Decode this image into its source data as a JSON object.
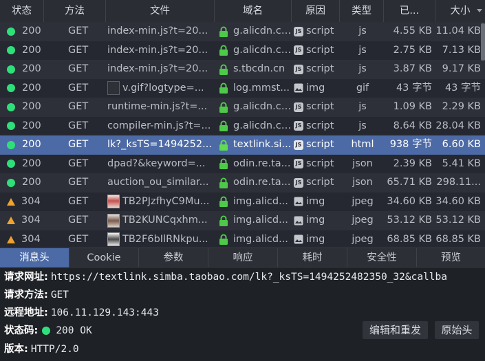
{
  "table": {
    "headers": {
      "status": "状态",
      "method": "方法",
      "file": "文件",
      "domain": "域名",
      "cause": "原因",
      "type": "类型",
      "transferred": "已...",
      "size": "大小"
    },
    "rows": [
      {
        "status": "200",
        "status_kind": "ok",
        "method": "GET",
        "file": "index-min.js?t=20...",
        "thumb": "",
        "domain": "g.alicdn.co...",
        "cause": "script",
        "cause_icon": "js",
        "type": "js",
        "transferred": "4.55 KB",
        "size": "11.04 KB"
      },
      {
        "status": "200",
        "status_kind": "ok",
        "method": "GET",
        "file": "index-min.js?t=20...",
        "thumb": "",
        "domain": "g.alicdn.co...",
        "cause": "script",
        "cause_icon": "js",
        "type": "js",
        "transferred": "2.75 KB",
        "size": "7.13 KB"
      },
      {
        "status": "200",
        "status_kind": "ok",
        "method": "GET",
        "file": "index-min.js?t=20...",
        "thumb": "",
        "domain": "s.tbcdn.cn",
        "cause": "script",
        "cause_icon": "js",
        "type": "js",
        "transferred": "3.87 KB",
        "size": "9.17 KB"
      },
      {
        "status": "200",
        "status_kind": "ok",
        "method": "GET",
        "file": "v.gif?logtype=...",
        "thumb": "blank",
        "domain": "log.mmst...",
        "cause": "img",
        "cause_icon": "js",
        "type": "gif",
        "transferred": "43 字节",
        "size": "43 字节"
      },
      {
        "status": "200",
        "status_kind": "ok",
        "method": "GET",
        "file": "runtime-min.js?t=...",
        "thumb": "",
        "domain": "g.alicdn.co...",
        "cause": "script",
        "cause_icon": "js",
        "type": "js",
        "transferred": "1.09 KB",
        "size": "2.29 KB"
      },
      {
        "status": "200",
        "status_kind": "ok",
        "method": "GET",
        "file": "compiler-min.js?t=...",
        "thumb": "",
        "domain": "g.alicdn.co...",
        "cause": "script",
        "cause_icon": "js",
        "type": "js",
        "transferred": "8.64 KB",
        "size": "28.04 KB"
      },
      {
        "status": "200",
        "status_kind": "ok",
        "method": "GET",
        "file": "lk?_ksTS=1494252...",
        "thumb": "",
        "domain": "textlink.si...",
        "cause": "script",
        "cause_icon": "js",
        "type": "html",
        "transferred": "938 字节",
        "size": "6.60 KB",
        "selected": true
      },
      {
        "status": "200",
        "status_kind": "ok",
        "method": "GET",
        "file": "dpad?&keyword=...",
        "thumb": "",
        "domain": "odin.re.ta...",
        "cause": "script",
        "cause_icon": "js",
        "type": "json",
        "transferred": "2.39 KB",
        "size": "5.41 KB"
      },
      {
        "status": "200",
        "status_kind": "ok",
        "method": "GET",
        "file": "auction_ou_similar...",
        "thumb": "",
        "domain": "odin.re.ta...",
        "cause": "script",
        "cause_icon": "js",
        "type": "json",
        "transferred": "65.71 KB",
        "size": "298.11..."
      },
      {
        "status": "304",
        "status_kind": "warn",
        "method": "GET",
        "file": "TB2PJzfhyC9Mu...",
        "thumb": "img1",
        "domain": "img.alicd...",
        "cause": "img",
        "cause_icon": "js",
        "type": "jpeg",
        "transferred": "34.60 KB",
        "size": "34.60 KB"
      },
      {
        "status": "304",
        "status_kind": "warn",
        "method": "GET",
        "file": "TB2KUNCqxhm...",
        "thumb": "img2",
        "domain": "img.alicd...",
        "cause": "img",
        "cause_icon": "js",
        "type": "jpeg",
        "transferred": "53.12 KB",
        "size": "53.12 KB"
      },
      {
        "status": "304",
        "status_kind": "warn",
        "method": "GET",
        "file": "TB2F6bIlRNkpu...",
        "thumb": "img3",
        "domain": "img.alicd...",
        "cause": "img",
        "cause_icon": "js",
        "type": "jpeg",
        "transferred": "68.85 KB",
        "size": "68.85 KB"
      }
    ]
  },
  "tabs": [
    {
      "label": "消息头",
      "active": true
    },
    {
      "label": "Cookie",
      "active": false
    },
    {
      "label": "参数",
      "active": false
    },
    {
      "label": "响应",
      "active": false
    },
    {
      "label": "耗时",
      "active": false
    },
    {
      "label": "安全性",
      "active": false
    },
    {
      "label": "预览",
      "active": false
    }
  ],
  "details": {
    "url_label": "请求网址:",
    "url_value": "https://textlink.simba.taobao.com/lk?_ksTS=1494252482350_32&callba",
    "method_label": "请求方法:",
    "method_value": "GET",
    "remote_label": "远程地址:",
    "remote_value": "106.11.129.143:443",
    "status_label": "状态码:",
    "status_value": "200 OK",
    "version_label": "版本:",
    "version_value": "HTTP/2.0",
    "resend_button": "编辑和重发",
    "raw_button": "原始头"
  },
  "colors": {
    "ok": "#2fe07a",
    "warn": "#f0a22e",
    "lock": "#4ec94a",
    "selected": "#4c6aa6"
  }
}
